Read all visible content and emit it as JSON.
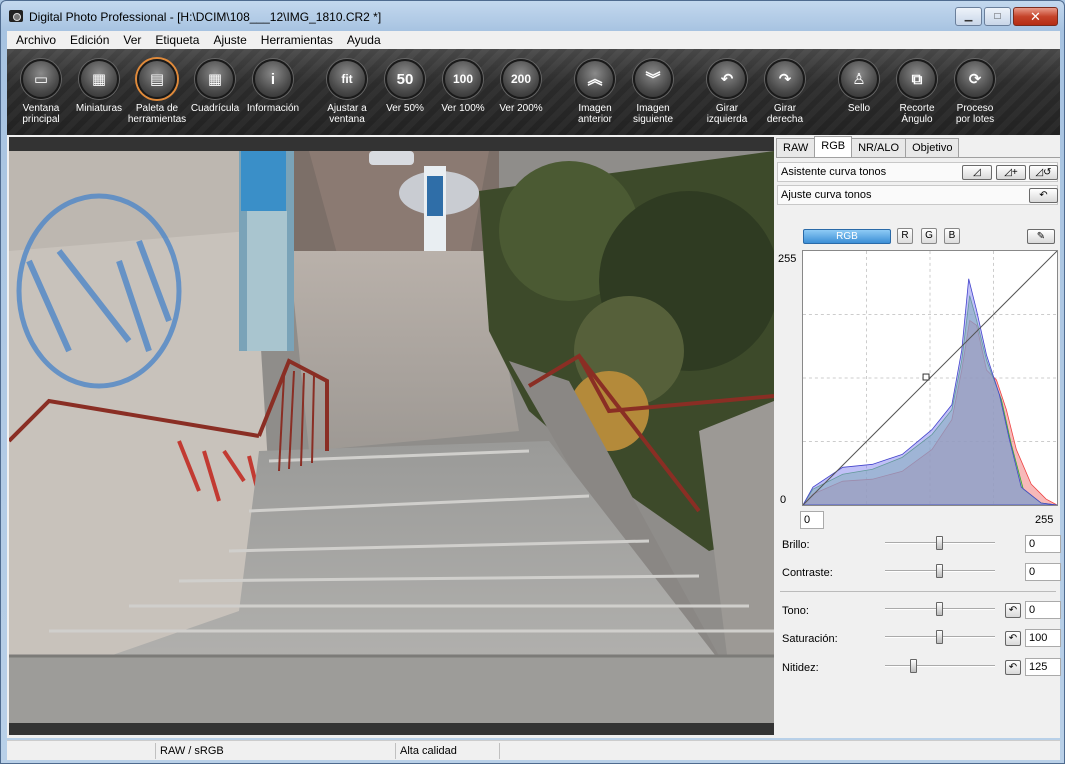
{
  "window": {
    "title": "Digital Photo Professional - [H:\\DCIM\\108___12\\IMG_1810.CR2 *]",
    "min": "▁",
    "max": "□",
    "close": "✕"
  },
  "menu": [
    "Archivo",
    "Edición",
    "Ver",
    "Etiqueta",
    "Ajuste",
    "Herramientas",
    "Ayuda"
  ],
  "toolbar": [
    {
      "label": "Ventana\nprincipal",
      "icon": "folder-icon",
      "glyph": "▭"
    },
    {
      "label": "Miniaturas",
      "icon": "thumbnails-icon",
      "glyph": "▦"
    },
    {
      "label": "Paleta de\nherramientas",
      "icon": "tool-palette-icon",
      "glyph": "▤",
      "active": true
    },
    {
      "label": "Cuadrícula",
      "icon": "grid-icon",
      "glyph": "▦"
    },
    {
      "label": "Información",
      "icon": "info-icon",
      "glyph": "i"
    },
    {
      "label": "Ajustar a\nventana",
      "icon": "fit-icon",
      "glyph": "fit"
    },
    {
      "label": "Ver 50%",
      "icon": "zoom-50-icon",
      "glyph": "50"
    },
    {
      "label": "Ver 100%",
      "icon": "zoom-100-icon",
      "glyph": "100"
    },
    {
      "label": "Ver 200%",
      "icon": "zoom-200-icon",
      "glyph": "200"
    },
    {
      "label": "Imagen\nanterior",
      "icon": "previous-image-icon",
      "glyph": "︽"
    },
    {
      "label": "Imagen\nsiguiente",
      "icon": "next-image-icon",
      "glyph": "︾"
    },
    {
      "label": "Girar izquierda",
      "icon": "rotate-left-icon",
      "glyph": "↶"
    },
    {
      "label": "Girar derecha",
      "icon": "rotate-right-icon",
      "glyph": "↷"
    },
    {
      "label": "Sello",
      "icon": "stamp-icon",
      "glyph": "♙"
    },
    {
      "label": "Recorte\nÁngulo",
      "icon": "crop-icon",
      "glyph": "⧉"
    },
    {
      "label": "Proceso\npor lotes",
      "icon": "batch-process-icon",
      "glyph": "⟳"
    }
  ],
  "panel": {
    "tabs": [
      "RAW",
      "RGB",
      "NR/ALO",
      "Objetivo"
    ],
    "selected_tab": "RGB",
    "curve_assist": "Asistente curva tonos",
    "curve_adjust": "Ajuste curva tonos",
    "channels": {
      "rgb": "RGB",
      "r": "R",
      "g": "G",
      "b": "B"
    },
    "axis": {
      "top": "255",
      "bottom": "0",
      "in_min": "0",
      "in_max": "255"
    },
    "brightness": {
      "label": "Brillo:",
      "value": "0",
      "level": 0.5
    },
    "contrast": {
      "label": "Contraste:",
      "value": "0",
      "level": 0.5
    },
    "hue": {
      "label": "Tono:",
      "value": "0",
      "level": 0.5
    },
    "saturation": {
      "label": "Saturación:",
      "value": "100",
      "level": 0.5
    },
    "sharpness": {
      "label": "Nitidez:",
      "value": "125",
      "level": 0.26
    }
  },
  "status": {
    "color": "RAW / sRGB",
    "quality": "Alta calidad"
  }
}
